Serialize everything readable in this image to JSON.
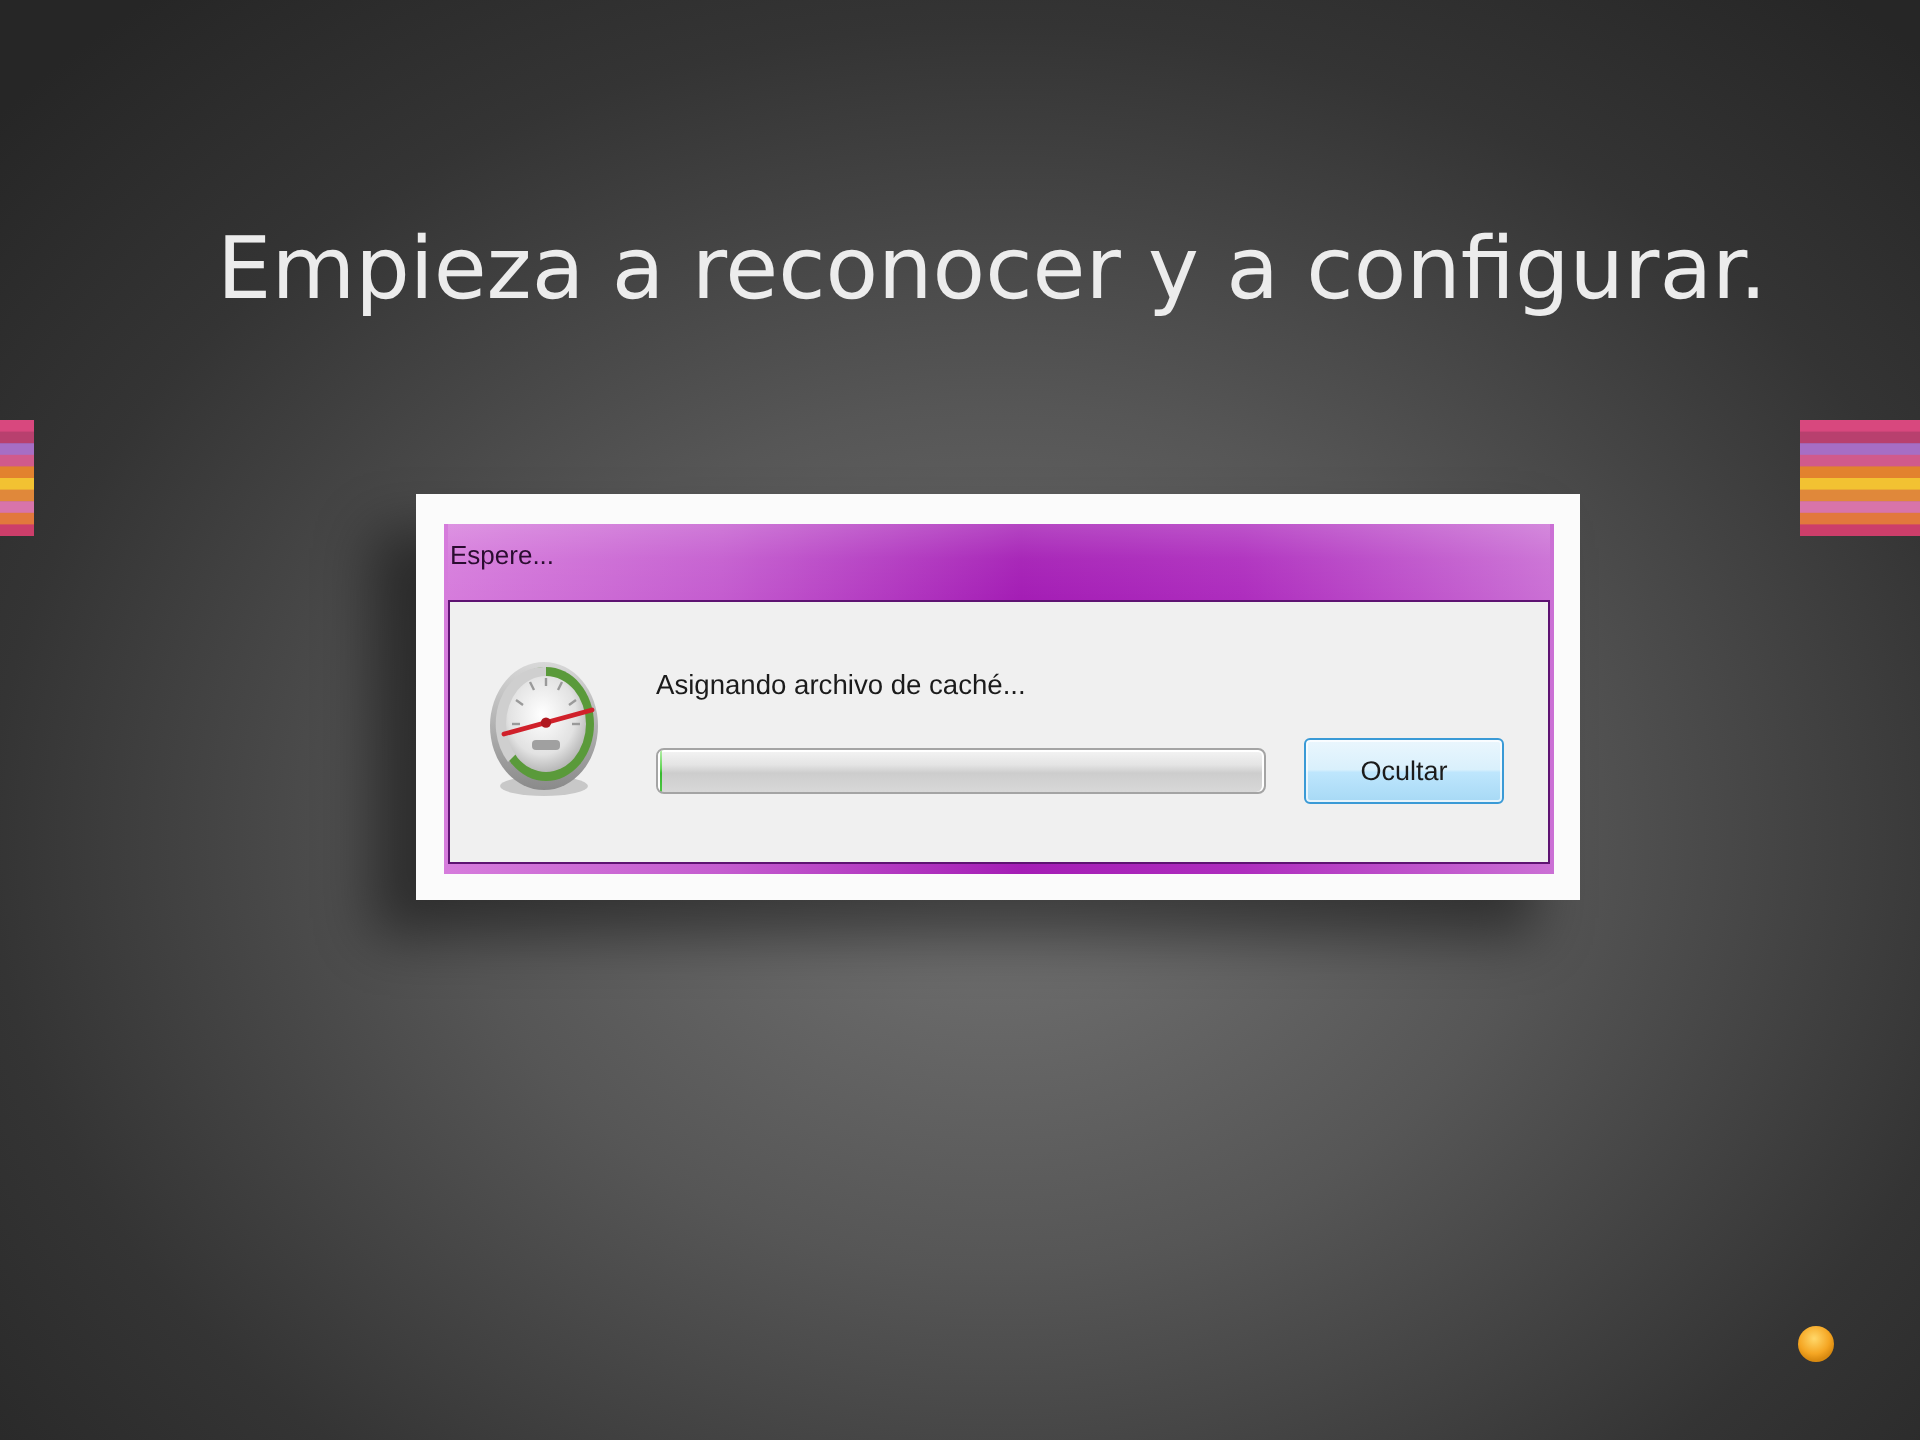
{
  "slide": {
    "title": "Empieza a reconocer y a configurar."
  },
  "dialog": {
    "title": "Espere...",
    "message": "Asignando archivo de caché...",
    "progress": {
      "level": 0
    },
    "buttons": [
      "Ocultar"
    ]
  }
}
